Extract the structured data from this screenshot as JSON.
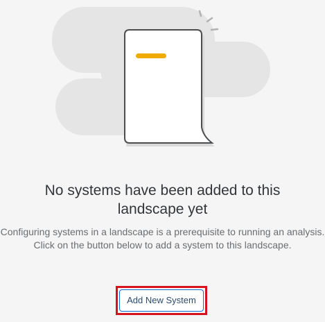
{
  "empty_state": {
    "title": "No systems have been added to this landscape yet",
    "description": "Configuring systems in a landscape is a prerequisite to running an analysis. Click on the button below to add a system to this landscape.",
    "button_label": "Add New System"
  },
  "colors": {
    "background": "#f5f5f5",
    "cloud": "#e5e5e5",
    "accent": "#f0ab00",
    "button_border": "#0a6ed1",
    "highlight": "#d7121f"
  }
}
